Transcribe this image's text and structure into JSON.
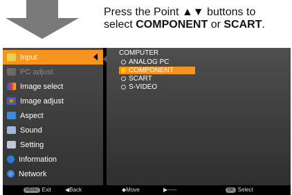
{
  "instruction": {
    "line1": "Press the Point ▲▼ buttons to",
    "line2_pre": "select ",
    "line2_bold1": "COMPONENT",
    "line2_mid": " or ",
    "line2_bold2": "SCART",
    "line2_end": "."
  },
  "menu": {
    "items": [
      {
        "label": "Input",
        "icon": "input-icon",
        "state": "selected"
      },
      {
        "label": "PC adjust",
        "icon": "pc-adjust-icon",
        "state": "disabled"
      },
      {
        "label": "Image select",
        "icon": "image-select-icon",
        "state": "normal"
      },
      {
        "label": "Image adjust",
        "icon": "image-adjust-icon",
        "state": "normal"
      },
      {
        "label": "Aspect",
        "icon": "aspect-icon",
        "state": "normal"
      },
      {
        "label": "Sound",
        "icon": "sound-icon",
        "state": "normal"
      },
      {
        "label": "Setting",
        "icon": "setting-icon",
        "state": "normal"
      },
      {
        "label": "Information",
        "icon": "information-icon",
        "state": "normal"
      },
      {
        "label": "Network",
        "icon": "network-icon",
        "state": "normal"
      }
    ]
  },
  "panel": {
    "title": "COMPUTER",
    "options": [
      {
        "label": "ANALOG PC",
        "selected": false
      },
      {
        "label": "COMPONENT",
        "selected": true
      },
      {
        "label": "SCART",
        "selected": false
      },
      {
        "label": "S-VIDEO",
        "selected": false
      }
    ]
  },
  "footer": {
    "exit_key": "MENU",
    "exit": "Exit",
    "back": "◀Back",
    "move": "◆Move",
    "next": "▶-----",
    "select_key": "OK",
    "select": "Select"
  },
  "colors": {
    "accent": "#f7941d",
    "menu_bg": "#3d3d3d",
    "selected_dot": "#ffd200"
  }
}
